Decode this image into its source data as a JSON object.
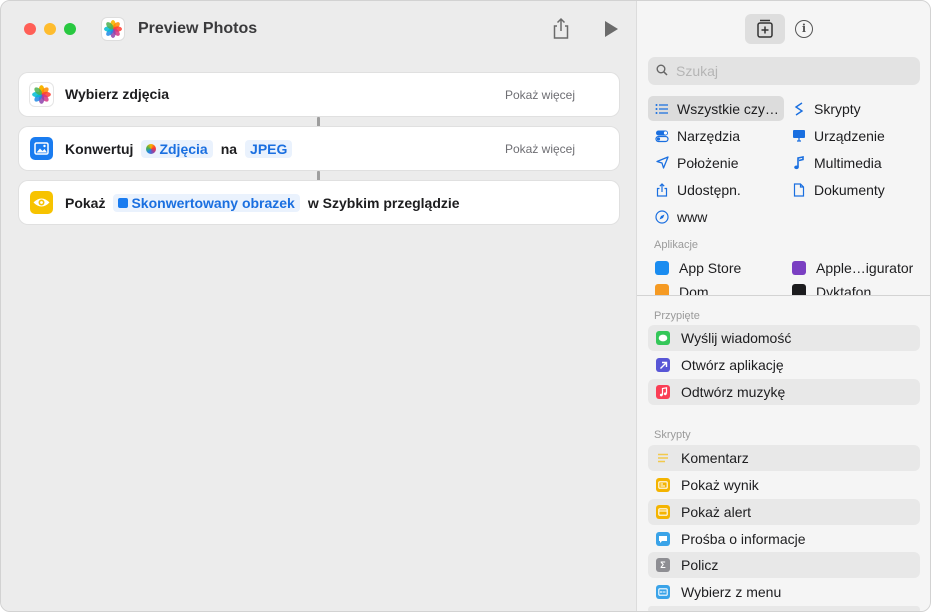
{
  "window": {
    "title": "Preview Photos"
  },
  "actions": [
    {
      "label": "Wybierz zdjęcia",
      "more": "Pokaż więcej"
    },
    {
      "prefix": "Konwertuj",
      "token1": "Zdjęcia",
      "middle": "na",
      "token2": "JPEG",
      "more": "Pokaż więcej"
    },
    {
      "prefix": "Pokaż",
      "token1": "Skonwertowany obrazek",
      "suffix": "w Szybkim przeglądzie"
    }
  ],
  "search": {
    "placeholder": "Szukaj"
  },
  "categories": [
    {
      "label": "Wszystkie czy…",
      "icon": "list-icon"
    },
    {
      "label": "Skrypty",
      "icon": "scripting-icon"
    },
    {
      "label": "Narzędzia",
      "icon": "toggle-icon"
    },
    {
      "label": "Urządzenie",
      "icon": "monitor-icon"
    },
    {
      "label": "Położenie",
      "icon": "location-arrow-icon"
    },
    {
      "label": "Multimedia",
      "icon": "music-note-icon"
    },
    {
      "label": "Udostępn.",
      "icon": "share-icon"
    },
    {
      "label": "Dokumenty",
      "icon": "document-icon"
    },
    {
      "label": "www",
      "icon": "compass-icon"
    }
  ],
  "apps_section": {
    "title": "Aplikacje",
    "items": [
      {
        "label": "App Store",
        "color": "#1a8cf0"
      },
      {
        "label": "Apple…igurator",
        "color": "#7a3fc2"
      },
      {
        "label": "Dom",
        "color": "#f59a23"
      },
      {
        "label": "Dyktafon",
        "color": "#1c1c1e"
      }
    ]
  },
  "pinned_section": {
    "title": "Przypięte",
    "items": [
      {
        "label": "Wyślij wiadomość",
        "color": "#34c759"
      },
      {
        "label": "Otwórz aplikację",
        "color": "#5856d6"
      },
      {
        "label": "Odtwórz muzykę",
        "color": "#fa3e55"
      }
    ]
  },
  "scripts_section": {
    "title": "Skrypty",
    "items": [
      {
        "label": "Komentarz",
        "color": "#f2c94c"
      },
      {
        "label": "Pokaż wynik",
        "color": "#f4b400"
      },
      {
        "label": "Pokaż alert",
        "color": "#f4b400"
      },
      {
        "label": "Prośba o informacje",
        "color": "#3aa3e8"
      },
      {
        "label": "Policz",
        "color": "#8e8e93"
      },
      {
        "label": "Wybierz z menu",
        "color": "#3aa3e8"
      }
    ]
  }
}
